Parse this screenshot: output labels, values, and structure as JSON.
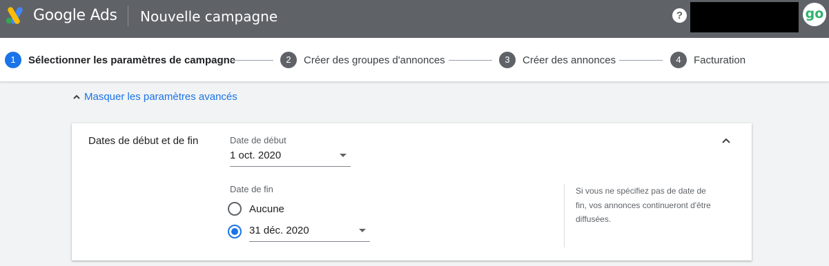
{
  "header": {
    "brand": "Google Ads",
    "title": "Nouvelle campagne",
    "help_glyph": "?",
    "avatar_text": "go",
    "logo_icon": "google-ads-logo",
    "colors": {
      "bar": "#5f6368",
      "avatar_text": "#2fb36d"
    }
  },
  "stepper": {
    "steps": [
      {
        "num": "1",
        "label": "Sélectionner les paramètres de campagne",
        "active": true
      },
      {
        "num": "2",
        "label": "Créer des groupes d'annonces",
        "active": false
      },
      {
        "num": "3",
        "label": "Créer des annonces",
        "active": false
      },
      {
        "num": "4",
        "label": "Facturation",
        "active": false
      }
    ],
    "colors": {
      "active": "#1a73e8",
      "inactive": "#5f6368"
    }
  },
  "advanced": {
    "label": "Masquer les paramètres avancés",
    "icon": "chevron-up-icon"
  },
  "dates": {
    "title": "Dates de début et de fin",
    "start_label": "Date de début",
    "start_value": "1 oct. 2020",
    "end_label": "Date de fin",
    "end_options": [
      {
        "label": "Aucune",
        "checked": false
      },
      {
        "label": "31 déc. 2020",
        "checked": true
      }
    ],
    "help_text": "Si vous ne spécifiez pas de date de fin, vos annonces continueront d'être diffusées."
  }
}
